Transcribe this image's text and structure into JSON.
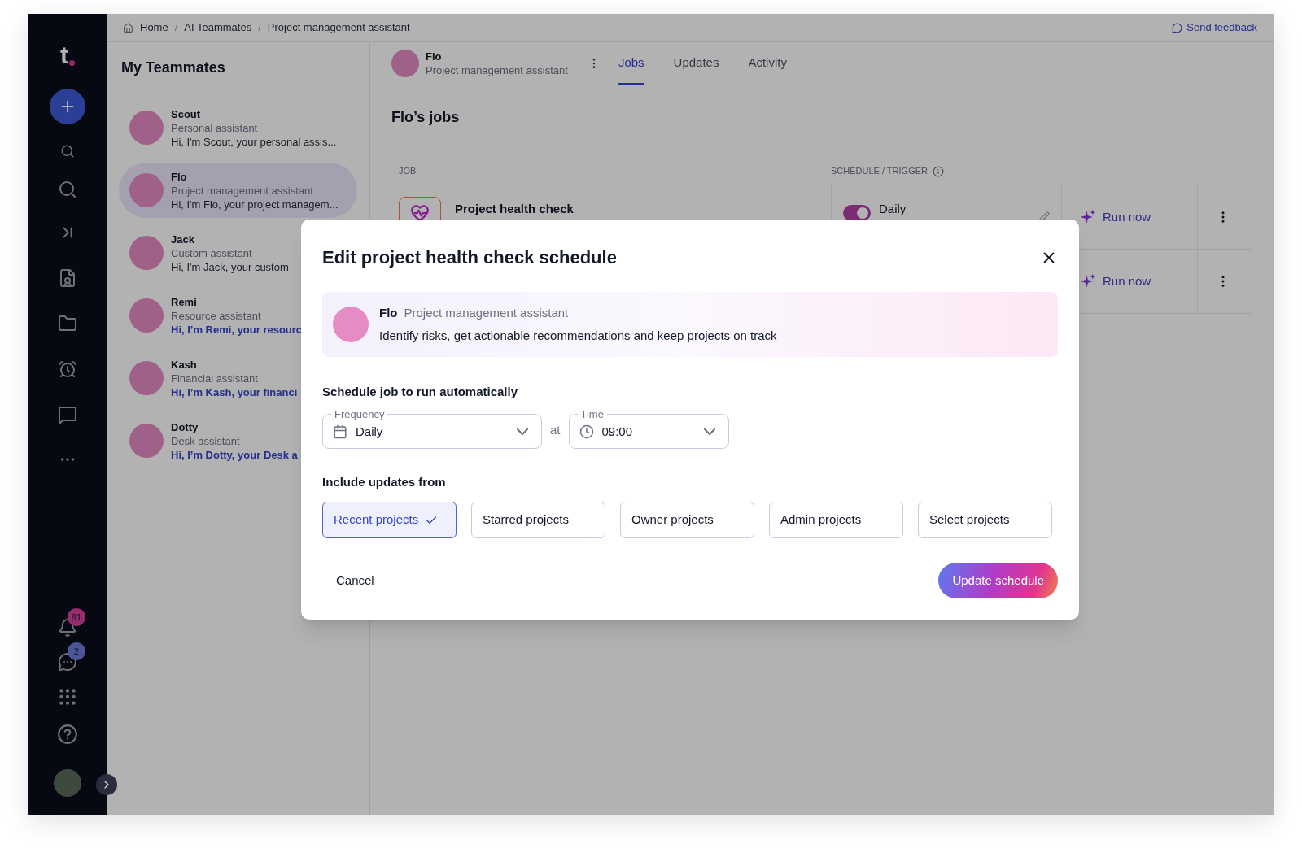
{
  "sidebar": {
    "logo": "t",
    "notifications_badge": "91",
    "messages_badge": "2"
  },
  "breadcrumb": {
    "items": [
      "Home",
      "AI Teammates",
      "Project management assistant"
    ],
    "separator": "/",
    "feedback": "Send feedback"
  },
  "teammates": {
    "title": "My Teammates",
    "items": [
      {
        "name": "Scout",
        "role": "Personal assistant",
        "message": "Hi, I'm Scout, your personal assis...",
        "unread": false,
        "selected": false
      },
      {
        "name": "Flo",
        "role": "Project management assistant",
        "message": "Hi, I'm Flo, your project managem...",
        "unread": false,
        "selected": true
      },
      {
        "name": "Jack",
        "role": "Custom assistant",
        "message": "Hi, I'm Jack, your custom",
        "unread": false,
        "selected": false
      },
      {
        "name": "Remi",
        "role": "Resource assistant",
        "message": "Hi, I’m Remi, your resourc",
        "unread": true,
        "selected": false
      },
      {
        "name": "Kash",
        "role": "Financial assistant",
        "message": "Hi, I’m Kash, your financi",
        "unread": true,
        "selected": false
      },
      {
        "name": "Dotty",
        "role": "Desk assistant",
        "message": "Hi, I’m Dotty, your Desk a",
        "unread": true,
        "selected": false
      }
    ]
  },
  "agent_header": {
    "name": "Flo",
    "role": "Project management assistant",
    "tabs": [
      {
        "label": "Jobs",
        "selected": true
      },
      {
        "label": "Updates",
        "selected": false
      },
      {
        "label": "Activity",
        "selected": false
      }
    ]
  },
  "jobs": {
    "title": "Flo’s jobs",
    "columns": [
      "JOB",
      "SCHEDULE / TRIGGER"
    ],
    "rows": [
      {
        "name": "Project health check",
        "schedule": "Daily",
        "on": true,
        "action": "Run now"
      },
      {
        "action": "Run now"
      }
    ]
  },
  "dialog": {
    "title": "Edit project health check schedule",
    "agent": {
      "name": "Flo",
      "role": "Project management assistant",
      "description": "Identify risks, get actionable recommendations and keep projects on track"
    },
    "schedule_label": "Schedule job to run automatically",
    "frequency": {
      "label": "Frequency",
      "value": "Daily"
    },
    "connector": "at",
    "time": {
      "label": "Time",
      "value": "09:00"
    },
    "include_label": "Include updates from",
    "options": [
      {
        "label": "Recent projects",
        "selected": true
      },
      {
        "label": "Starred projects",
        "selected": false
      },
      {
        "label": "Owner projects",
        "selected": false
      },
      {
        "label": "Admin projects",
        "selected": false
      },
      {
        "label": "Select projects",
        "selected": false
      }
    ],
    "cancel": "Cancel",
    "submit": "Update schedule"
  }
}
